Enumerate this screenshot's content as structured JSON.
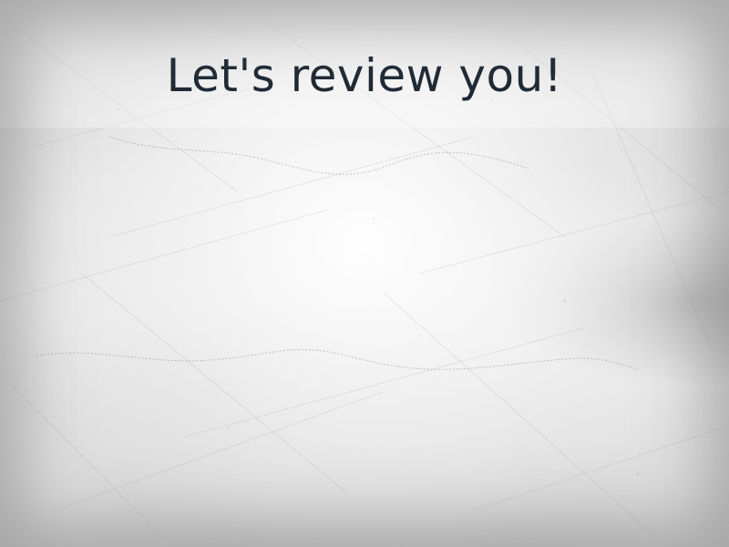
{
  "slide": {
    "title": "Let's review you!"
  },
  "colors": {
    "title_text": "#1f2a36",
    "background": "#eeeeee"
  }
}
